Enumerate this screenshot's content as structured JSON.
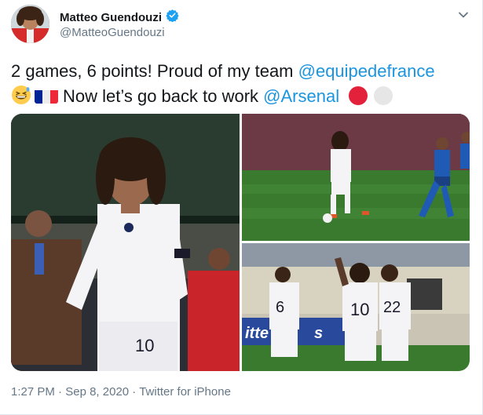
{
  "author": {
    "name": "Matteo Guendouzi",
    "handle": "@MatteoGuendouzi",
    "verified": true
  },
  "tweet": {
    "line1_text": "2 games, 6 points! Proud of my team ",
    "line1_mention": "@equipedefrance",
    "line2_text": "Now let’s go back to work ",
    "line2_mention": "@Arsenal"
  },
  "photos": {
    "shirt_number_main": "10",
    "shirt_number_left_player": "6",
    "shirt_number_center": "10",
    "shirt_number_right_player": "22",
    "ad_board_text": "itte",
    "ad_board_text_2": "s"
  },
  "meta": {
    "time": "1:27 PM",
    "sep1": " · ",
    "date": "Sep 8, 2020",
    "sep2": " · ",
    "source": "Twitter for iPhone"
  },
  "colors": {
    "link": "#1b95e0",
    "verified": "#1da1f2",
    "arsenal_red": "#e3213a",
    "arsenal_white": "#e6e6e6",
    "pitch_green": "#3a7a2e"
  },
  "icons": [
    "verified-badge-icon",
    "chevron-down-icon",
    "grinning-sweat-emoji-icon",
    "france-flag-icon",
    "red-circle-icon",
    "white-circle-icon"
  ]
}
